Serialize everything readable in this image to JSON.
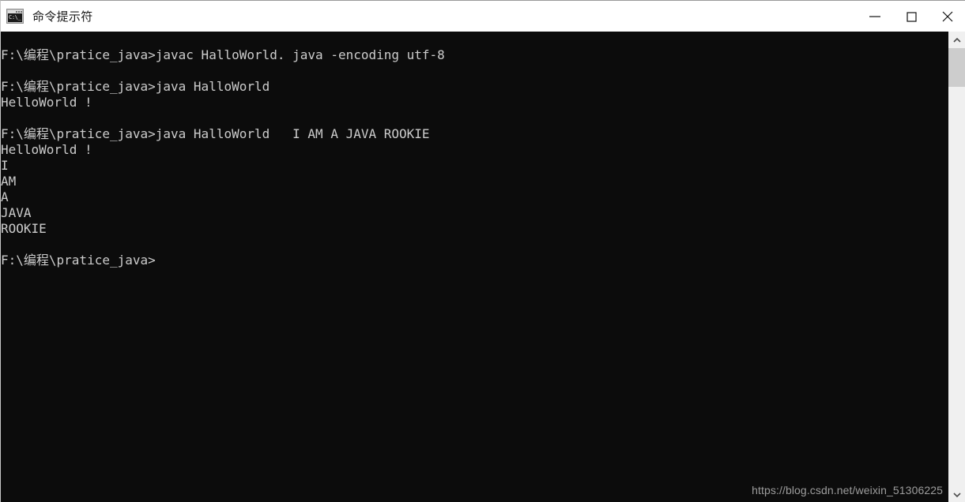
{
  "window": {
    "title": "命令提示符",
    "icon_name": "command-prompt-icon",
    "icon_glyph": "C:\\_",
    "background": "#0c0c0c",
    "text_color": "#cccccc",
    "titlebar_background": "#ffffff"
  },
  "controls": {
    "minimize_label": "最小化",
    "maximize_label": "最大化",
    "close_label": "关闭"
  },
  "console": {
    "lines": [
      "F:\\编程\\pratice_java>javac HalloWorld. java -encoding utf-8",
      "",
      "F:\\编程\\pratice_java>java HalloWorld",
      "HelloWorld !",
      "",
      "F:\\编程\\pratice_java>java HalloWorld   I AM A JAVA ROOKIE",
      "HelloWorld !",
      "I",
      "AM",
      "A",
      "JAVA",
      "ROOKIE",
      "",
      "F:\\编程\\pratice_java>"
    ],
    "text": "F:\\编程\\pratice_java>javac HalloWorld. java -encoding utf-8\n\nF:\\编程\\pratice_java>java HalloWorld\nHelloWorld !\n\nF:\\编程\\pratice_java>java HalloWorld   I AM A JAVA ROOKIE\nHelloWorld !\nI\nAM\nA\nJAVA\nROOKIE\n\nF:\\编程\\pratice_java>"
  },
  "watermark": {
    "text": "https://blog.csdn.net/weixin_51306225"
  },
  "scrollbar": {
    "up_label": "向上滚动",
    "down_label": "向下滚动",
    "thumb_label": "滚动条滑块",
    "thumb_color": "#cdcdcd",
    "track_color": "#f0f0f0"
  }
}
